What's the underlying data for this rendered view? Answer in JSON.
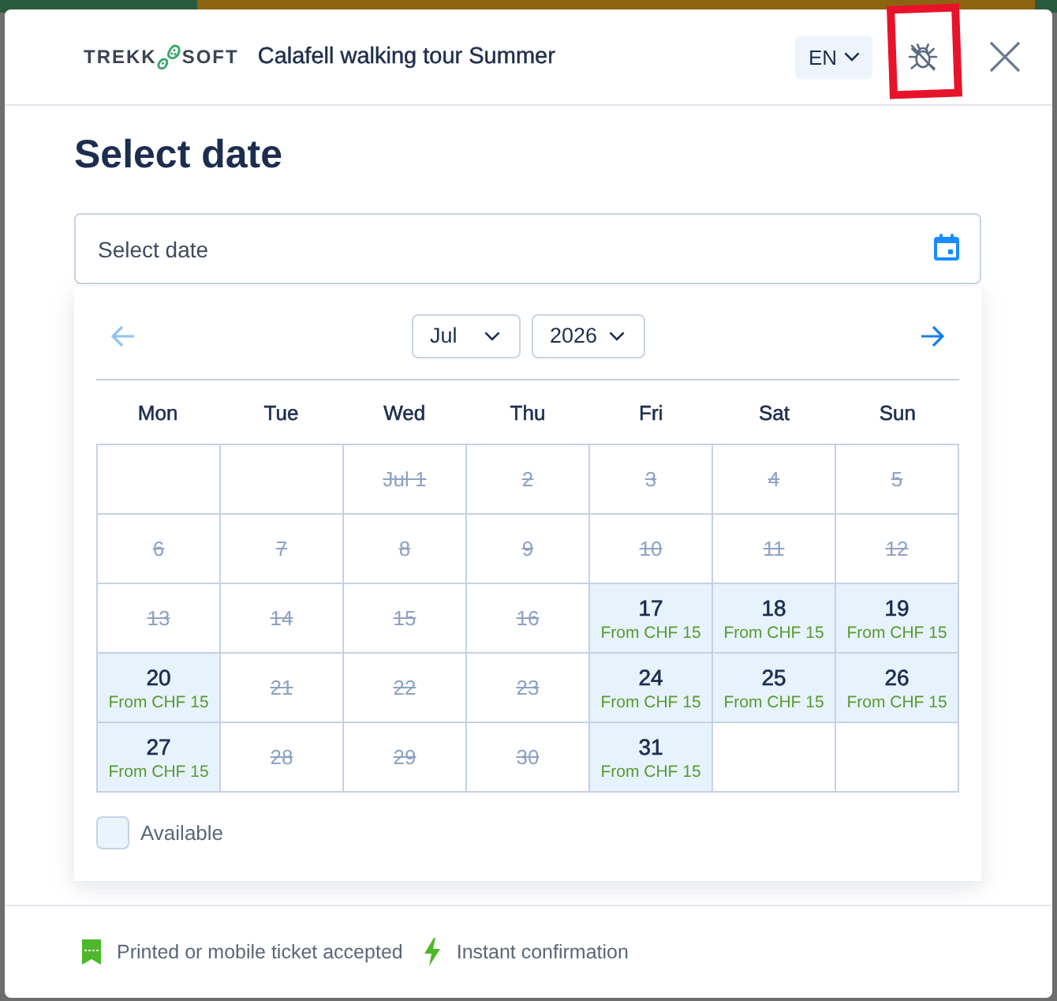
{
  "header": {
    "brand": {
      "left": "TREKK",
      "right": "SOFT"
    },
    "title": "Calafell walking tour Summer",
    "language": "EN",
    "bug_button": {
      "highlighted": true
    }
  },
  "heading": "Select date",
  "date_field": {
    "placeholder": "Select date"
  },
  "calendar": {
    "previous": {
      "disabled": true
    },
    "next": {
      "disabled": false
    },
    "month": "Jul",
    "year": "2026",
    "weekdays": [
      "Mon",
      "Tue",
      "Wed",
      "Thu",
      "Fri",
      "Sat",
      "Sun"
    ],
    "weeks": [
      [
        {
          "kind": "empty"
        },
        {
          "kind": "empty"
        },
        {
          "kind": "day",
          "label": "Jul 1",
          "available": false
        },
        {
          "kind": "day",
          "label": "2",
          "available": false
        },
        {
          "kind": "day",
          "label": "3",
          "available": false
        },
        {
          "kind": "day",
          "label": "4",
          "available": false
        },
        {
          "kind": "day",
          "label": "5",
          "available": false
        }
      ],
      [
        {
          "kind": "day",
          "label": "6",
          "available": false
        },
        {
          "kind": "day",
          "label": "7",
          "available": false
        },
        {
          "kind": "day",
          "label": "8",
          "available": false
        },
        {
          "kind": "day",
          "label": "9",
          "available": false
        },
        {
          "kind": "day",
          "label": "10",
          "available": false
        },
        {
          "kind": "day",
          "label": "11",
          "available": false
        },
        {
          "kind": "day",
          "label": "12",
          "available": false
        }
      ],
      [
        {
          "kind": "day",
          "label": "13",
          "available": false
        },
        {
          "kind": "day",
          "label": "14",
          "available": false
        },
        {
          "kind": "day",
          "label": "15",
          "available": false
        },
        {
          "kind": "day",
          "label": "16",
          "available": false
        },
        {
          "kind": "day",
          "label": "17",
          "available": true,
          "price": "From CHF 15"
        },
        {
          "kind": "day",
          "label": "18",
          "available": true,
          "price": "From CHF 15"
        },
        {
          "kind": "day",
          "label": "19",
          "available": true,
          "price": "From CHF 15"
        }
      ],
      [
        {
          "kind": "day",
          "label": "20",
          "available": true,
          "price": "From CHF 15"
        },
        {
          "kind": "day",
          "label": "21",
          "available": false
        },
        {
          "kind": "day",
          "label": "22",
          "available": false
        },
        {
          "kind": "day",
          "label": "23",
          "available": false
        },
        {
          "kind": "day",
          "label": "24",
          "available": true,
          "price": "From CHF 15"
        },
        {
          "kind": "day",
          "label": "25",
          "available": true,
          "price": "From CHF 15"
        },
        {
          "kind": "day",
          "label": "26",
          "available": true,
          "price": "From CHF 15"
        }
      ],
      [
        {
          "kind": "day",
          "label": "27",
          "available": true,
          "price": "From CHF 15"
        },
        {
          "kind": "day",
          "label": "28",
          "available": false
        },
        {
          "kind": "day",
          "label": "29",
          "available": false
        },
        {
          "kind": "day",
          "label": "30",
          "available": false
        },
        {
          "kind": "day",
          "label": "31",
          "available": true,
          "price": "From CHF 15"
        },
        {
          "kind": "empty"
        },
        {
          "kind": "empty"
        }
      ]
    ],
    "legend": {
      "label": "Available"
    }
  },
  "footer": {
    "features": [
      {
        "kind": "ticket",
        "text": "Printed or mobile ticket accepted"
      },
      {
        "kind": "bolt",
        "text": "Instant confirmation"
      }
    ]
  }
}
